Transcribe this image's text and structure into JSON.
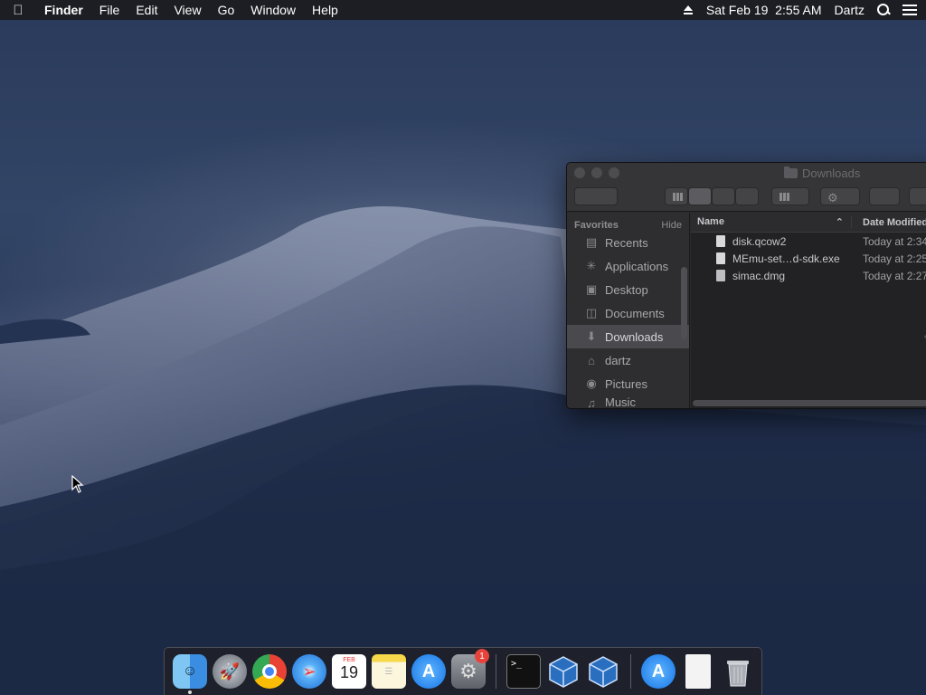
{
  "menubar": {
    "apple_icon": "apple-icon",
    "app_name": "Finder",
    "menus": [
      "File",
      "Edit",
      "View",
      "Go",
      "Window",
      "Help"
    ],
    "datetime": "Sat Feb 19  2:55 AM",
    "user": "Dartz"
  },
  "finder": {
    "title": "Downloads",
    "sidebar_header": "Favorites",
    "sidebar_hide": "Hide",
    "sidebar_items": [
      {
        "label": "Recents",
        "icon": "recents-icon"
      },
      {
        "label": "Applications",
        "icon": "applications-icon"
      },
      {
        "label": "Desktop",
        "icon": "desktop-icon"
      },
      {
        "label": "Documents",
        "icon": "documents-icon"
      },
      {
        "label": "Downloads",
        "icon": "downloads-icon",
        "selected": true
      },
      {
        "label": "dartz",
        "icon": "home-icon"
      },
      {
        "label": "Pictures",
        "icon": "pictures-icon"
      },
      {
        "label": "Music",
        "icon": "music-icon"
      }
    ],
    "columns": {
      "name": "Name",
      "date": "Date Modified"
    },
    "files": [
      {
        "name": "disk.qcow2",
        "date": "Today at 2:34"
      },
      {
        "name": "MEmu-set…d-sdk.exe",
        "date": "Today at 2:25"
      },
      {
        "name": "simac.dmg",
        "date": "Today at 2:27"
      }
    ]
  },
  "dock": {
    "apps": [
      {
        "name": "Finder",
        "icon": "finder-icon",
        "running": true
      },
      {
        "name": "Launchpad",
        "icon": "launchpad-icon"
      },
      {
        "name": "Chrome",
        "icon": "chrome-icon"
      },
      {
        "name": "Safari",
        "icon": "safari-icon"
      },
      {
        "name": "Calendar",
        "icon": "calendar-icon",
        "month": "FEB",
        "day": "19"
      },
      {
        "name": "Notes",
        "icon": "notes-icon"
      },
      {
        "name": "App Store",
        "icon": "app-store-icon"
      },
      {
        "name": "System Preferences",
        "icon": "system-preferences-icon",
        "badge": "1"
      },
      {
        "name": "Terminal",
        "icon": "terminal-icon",
        "prompt": ">_"
      },
      {
        "name": "VirtualBox",
        "icon": "virtualbox-icon"
      },
      {
        "name": "VirtualBox VM",
        "icon": "virtualbox-vm-icon"
      },
      {
        "name": "App Store Downloads",
        "icon": "app-store-folder-icon"
      },
      {
        "name": "Document",
        "icon": "document-icon"
      },
      {
        "name": "Trash",
        "icon": "trash-icon"
      }
    ]
  },
  "colors": {
    "accent": "#0a84ff",
    "badge": "#e8433b"
  }
}
